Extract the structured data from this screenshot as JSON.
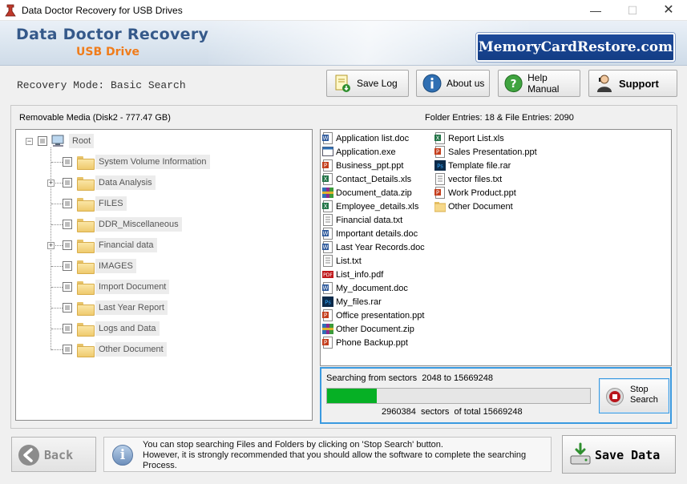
{
  "window": {
    "title": "Data Doctor Recovery for USB Drives",
    "minimize_icon": "minimize-icon",
    "maximize_icon": "maximize-icon",
    "close_icon": "close-icon"
  },
  "banner": {
    "brand_line1": "Data Doctor Recovery",
    "brand_line2": "USB Drive",
    "site": "MemoryCardRestore.com",
    "brand_color": "#35598a",
    "accent_color": "#f07c1a"
  },
  "toolbar": {
    "mode": "Recovery Mode: Basic Search",
    "save_log": "Save Log",
    "about": "About us",
    "help": "Help Manual",
    "support": "Support"
  },
  "tree": {
    "header": "Removable Media (Disk2 - 777.47 GB)",
    "root": "Root",
    "items": [
      {
        "label": "System Volume Information",
        "expandable": false
      },
      {
        "label": "Data Analysis",
        "expandable": true
      },
      {
        "label": "FILES",
        "expandable": false
      },
      {
        "label": "DDR_Miscellaneous",
        "expandable": false
      },
      {
        "label": "Financial data",
        "expandable": true
      },
      {
        "label": "IMAGES",
        "expandable": false
      },
      {
        "label": "Import Document",
        "expandable": false
      },
      {
        "label": "Last Year Report",
        "expandable": false
      },
      {
        "label": "Logs and Data",
        "expandable": false
      },
      {
        "label": "Other Document",
        "expandable": false
      }
    ]
  },
  "files": {
    "header": "Folder Entries: 18 & File Entries: 2090",
    "column1": [
      {
        "name": "Application list.doc",
        "icon": "word-icon"
      },
      {
        "name": "Application.exe",
        "icon": "exe-icon"
      },
      {
        "name": "Business_ppt.ppt",
        "icon": "powerpoint-icon"
      },
      {
        "name": "Contact_Details.xls",
        "icon": "excel-icon"
      },
      {
        "name": "Document_data.zip",
        "icon": "zip-icon"
      },
      {
        "name": "Employee_details.xls",
        "icon": "excel-icon"
      },
      {
        "name": "Financial data.txt",
        "icon": "text-icon"
      },
      {
        "name": "Important details.doc",
        "icon": "word-icon"
      },
      {
        "name": "Last Year Records.doc",
        "icon": "word-icon"
      },
      {
        "name": "List.txt",
        "icon": "text-icon"
      },
      {
        "name": "List_info.pdf",
        "icon": "pdf-icon"
      },
      {
        "name": "My_document.doc",
        "icon": "word-icon"
      },
      {
        "name": "My_files.rar",
        "icon": "photoshop-icon"
      },
      {
        "name": "Office presentation.ppt",
        "icon": "powerpoint-icon"
      },
      {
        "name": "Other Document.zip",
        "icon": "zip-icon"
      },
      {
        "name": "Phone Backup.ppt",
        "icon": "powerpoint-icon"
      }
    ],
    "column2": [
      {
        "name": "Report List.xls",
        "icon": "excel-icon"
      },
      {
        "name": "Sales Presentation.ppt",
        "icon": "powerpoint-icon"
      },
      {
        "name": "Template file.rar",
        "icon": "photoshop-icon"
      },
      {
        "name": "vector files.txt",
        "icon": "text-icon"
      },
      {
        "name": "Work Product.ppt",
        "icon": "powerpoint-icon"
      },
      {
        "name": "Other Document",
        "icon": "folder-icon"
      }
    ]
  },
  "progress": {
    "search_prefix": "Searching from sectors",
    "start_sector": "2048",
    "to_word": "to",
    "end_sector": "15669248",
    "current": "2960384",
    "sectors_word": "sectors",
    "of_total_word": "of  total",
    "total": "15669248",
    "fraction": 0.189,
    "fill_color": "#06b025",
    "stop_line1": "Stop",
    "stop_line2": "Search"
  },
  "footer": {
    "back": "Back",
    "info_line1": "You can stop searching Files and Folders by clicking on 'Stop Search' button.",
    "info_line2": "However, it is strongly recommended that you should allow the software to complete the searching",
    "info_line3": "Process.",
    "save": "Save Data"
  }
}
